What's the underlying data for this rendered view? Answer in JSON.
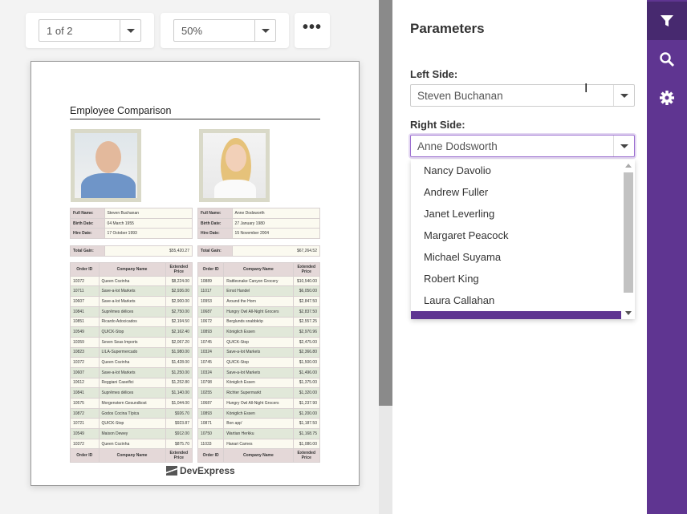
{
  "toolbar": {
    "page_selector": "1 of 2",
    "zoom_selector": "50%",
    "more_label": "•••"
  },
  "report": {
    "title": "Employee Comparison",
    "logo": "DevExpress",
    "labels": {
      "full_name": "Full Name:",
      "birth_date": "Birth Date:",
      "hire_date": "Hire Date:",
      "total_gain": "Total Gain:",
      "order_id": "Order ID",
      "company": "Company Name",
      "price": "Extended Price"
    },
    "left": {
      "full_name": "Steven Buchanan",
      "birth_date": "04 March 1955",
      "hire_date": "17 October 1993",
      "total_gain": "$55,420.27",
      "orders": [
        [
          "10372",
          "Queen Cozinha",
          "$8,224.00"
        ],
        [
          "10711",
          "Save-a-lot Markets",
          "$2,936.00"
        ],
        [
          "10607",
          "Save-a-lot Markets",
          "$2,900.00"
        ],
        [
          "10841",
          "Suprêmes délices",
          "$2,750.00"
        ],
        [
          "10851",
          "Ricardo Adocicados",
          "$2,194.50"
        ],
        [
          "10549",
          "QUICK-Stop",
          "$2,162.40"
        ],
        [
          "10359",
          "Seven Seas Imports",
          "$2,067.20"
        ],
        [
          "10823",
          "LILA-Supermercado",
          "$1,980.00"
        ],
        [
          "10372",
          "Queen Cozinha",
          "$1,428.00"
        ],
        [
          "10607",
          "Save-a-lot Markets",
          "$1,250.00"
        ],
        [
          "10612",
          "Reggiani Caseifici",
          "$1,252.80"
        ],
        [
          "10841",
          "Suprêmes délices",
          "$1,140.00"
        ],
        [
          "10575",
          "Morgenstern Gesundkost",
          "$1,044.00"
        ],
        [
          "10872",
          "Godos Cocina Típica",
          "$926.70"
        ],
        [
          "10721",
          "QUICK-Stop",
          "$923.87"
        ],
        [
          "10549",
          "Maison Dewey",
          "$912.00"
        ],
        [
          "10372",
          "Queen Cozinha",
          "$875.70"
        ]
      ]
    },
    "right": {
      "full_name": "Anne Dodsworth",
      "birth_date": "27 January 1980",
      "hire_date": "15 November 2004",
      "total_gain": "$67,264.52",
      "orders": [
        [
          "10889",
          "Rattlesnake Canyon Grocery",
          "$10,540.00"
        ],
        [
          "11017",
          "Ernst Handel",
          "$6,050.00"
        ],
        [
          "10953",
          "Around the Horn",
          "$2,847.50"
        ],
        [
          "10687",
          "Hungry Owl All-Night Grocers",
          "$2,837.50"
        ],
        [
          "10672",
          "Berglunds snabbköp",
          "$2,557.25"
        ],
        [
          "10893",
          "Königlich Essen",
          "$2,970.96"
        ],
        [
          "10745",
          "QUICK-Stop",
          "$2,475.00"
        ],
        [
          "10324",
          "Save-a-lot Markets",
          "$2,366.80"
        ],
        [
          "10745",
          "QUICK-Stop",
          "$1,500.00"
        ],
        [
          "10324",
          "Save-a-lot Markets",
          "$1,496.00"
        ],
        [
          "10798",
          "Königlich Essen",
          "$1,375.00"
        ],
        [
          "10255",
          "Richter Supermarkt",
          "$1,320.00"
        ],
        [
          "10687",
          "Hungry Owl All-Night Grocers",
          "$1,237.90"
        ],
        [
          "10893",
          "Königlich Essen",
          "$1,200.00"
        ],
        [
          "10871",
          "Bon app'",
          "$1,187.50"
        ],
        [
          "10750",
          "Wartian Herkku",
          "$1,168.75"
        ],
        [
          "11033",
          "Hanari Carnes",
          "$1,080.00"
        ]
      ]
    }
  },
  "panel": {
    "title": "Parameters",
    "left_label": "Left Side:",
    "left_value": "Steven Buchanan",
    "right_label": "Right Side:",
    "right_value": "Anne Dodsworth",
    "options": [
      "Nancy Davolio",
      "Andrew Fuller",
      "Janet Leverling",
      "Margaret Peacock",
      "Michael Suyama",
      "Robert King",
      "Laura Callahan"
    ]
  },
  "sidebar": {
    "items": [
      {
        "icon": "filter-icon",
        "active": true
      },
      {
        "icon": "search-icon"
      },
      {
        "icon": "gear-icon"
      }
    ]
  },
  "colors": {
    "accent": "#5f3591",
    "accent_dark": "#47296f"
  }
}
